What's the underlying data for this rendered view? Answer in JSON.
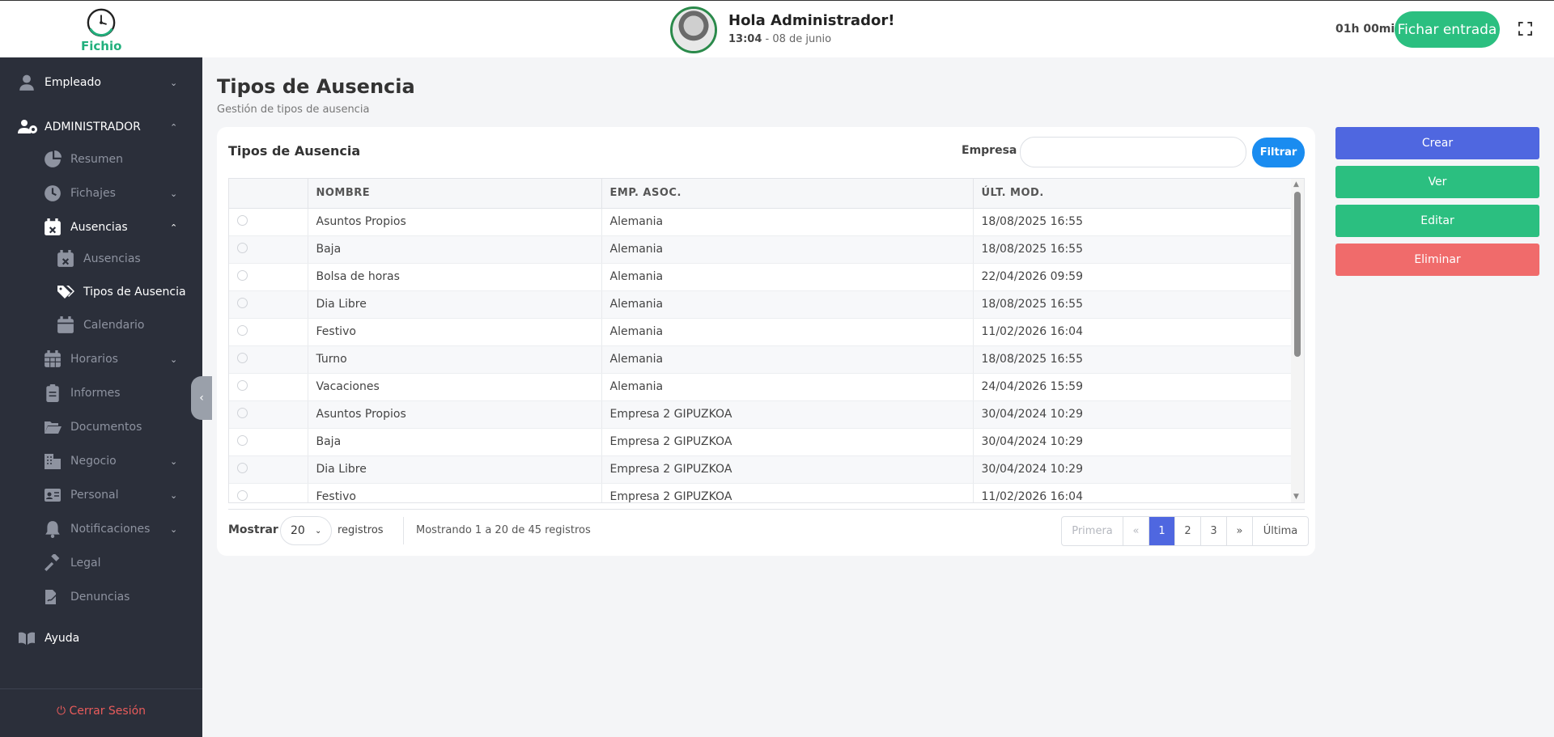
{
  "header": {
    "logo_text": "Fichio",
    "greeting": "Hola Administrador!",
    "time": "13:04",
    "date": " - 08 de junio",
    "timer": "01h 00min",
    "clock_in_label": "Fichar entrada"
  },
  "sidebar": {
    "items": [
      {
        "label": "Empleado",
        "icon": "user-icon"
      },
      {
        "label": "ADMINISTRADOR",
        "icon": "users-gear-icon"
      },
      {
        "label": "Resumen",
        "icon": "pie-chart-icon"
      },
      {
        "label": "Fichajes",
        "icon": "clock-icon"
      },
      {
        "label": "Ausencias",
        "icon": "calendar-x-icon"
      },
      {
        "label": "Ausencias",
        "icon": "calendar-x-icon"
      },
      {
        "label": "Tipos de Ausencia",
        "icon": "tags-icon"
      },
      {
        "label": "Calendario",
        "icon": "calendar-icon"
      },
      {
        "label": "Horarios",
        "icon": "calendar-grid-icon"
      },
      {
        "label": "Informes",
        "icon": "clipboard-icon"
      },
      {
        "label": "Documentos",
        "icon": "folder-open-icon"
      },
      {
        "label": "Negocio",
        "icon": "building-icon"
      },
      {
        "label": "Personal",
        "icon": "id-card-icon"
      },
      {
        "label": "Notificaciones",
        "icon": "bell-icon"
      },
      {
        "label": "Legal",
        "icon": "gavel-icon"
      },
      {
        "label": "Denuncias",
        "icon": "file-signature-icon"
      },
      {
        "label": "Ayuda",
        "icon": "book-icon"
      }
    ],
    "logout_label": "Cerrar Sesión"
  },
  "page": {
    "title": "Tipos de Ausencia",
    "subtitle": "Gestión de tipos de ausencia"
  },
  "card": {
    "title": "Tipos de Ausencia",
    "filter_label": "Empresa",
    "filter_value": "",
    "filter_button": "Filtrar"
  },
  "table": {
    "headers": [
      "",
      "NOMBRE",
      "EMP. ASOC.",
      "ÚLT. MOD."
    ],
    "rows": [
      [
        "Asuntos Propios",
        "Alemania",
        "18/08/2025 16:55"
      ],
      [
        "Baja",
        "Alemania",
        "18/08/2025 16:55"
      ],
      [
        "Bolsa de horas",
        "Alemania",
        "22/04/2026 09:59"
      ],
      [
        "Dia Libre",
        "Alemania",
        "18/08/2025 16:55"
      ],
      [
        "Festivo",
        "Alemania",
        "11/02/2026 16:04"
      ],
      [
        "Turno",
        "Alemania",
        "18/08/2025 16:55"
      ],
      [
        "Vacaciones",
        "Alemania",
        "24/04/2026 15:59"
      ],
      [
        "Asuntos Propios",
        "Empresa 2 GIPUZKOA",
        "30/04/2024 10:29"
      ],
      [
        "Baja",
        "Empresa 2 GIPUZKOA",
        "30/04/2024 10:29"
      ],
      [
        "Dia Libre",
        "Empresa 2 GIPUZKOA",
        "30/04/2024 10:29"
      ],
      [
        "Festivo",
        "Empresa 2 GIPUZKOA",
        "11/02/2026 16:04"
      ]
    ]
  },
  "footer": {
    "show_label": "Mostrar",
    "page_size": "20",
    "records_label": "registros",
    "info": "Mostrando 1 a 20 de 45 registros",
    "pager": [
      "Primera",
      "«",
      "1",
      "2",
      "3",
      "»",
      "Última"
    ]
  },
  "actions": {
    "create": "Crear",
    "view": "Ver",
    "edit": "Editar",
    "delete": "Eliminar"
  },
  "colors": {
    "accent_green": "#2bbf80",
    "primary_blue": "#4f67e0",
    "filter_blue": "#1a8cf0",
    "danger_red": "#f06b6b",
    "sidebar_bg": "#2b2f3a"
  }
}
